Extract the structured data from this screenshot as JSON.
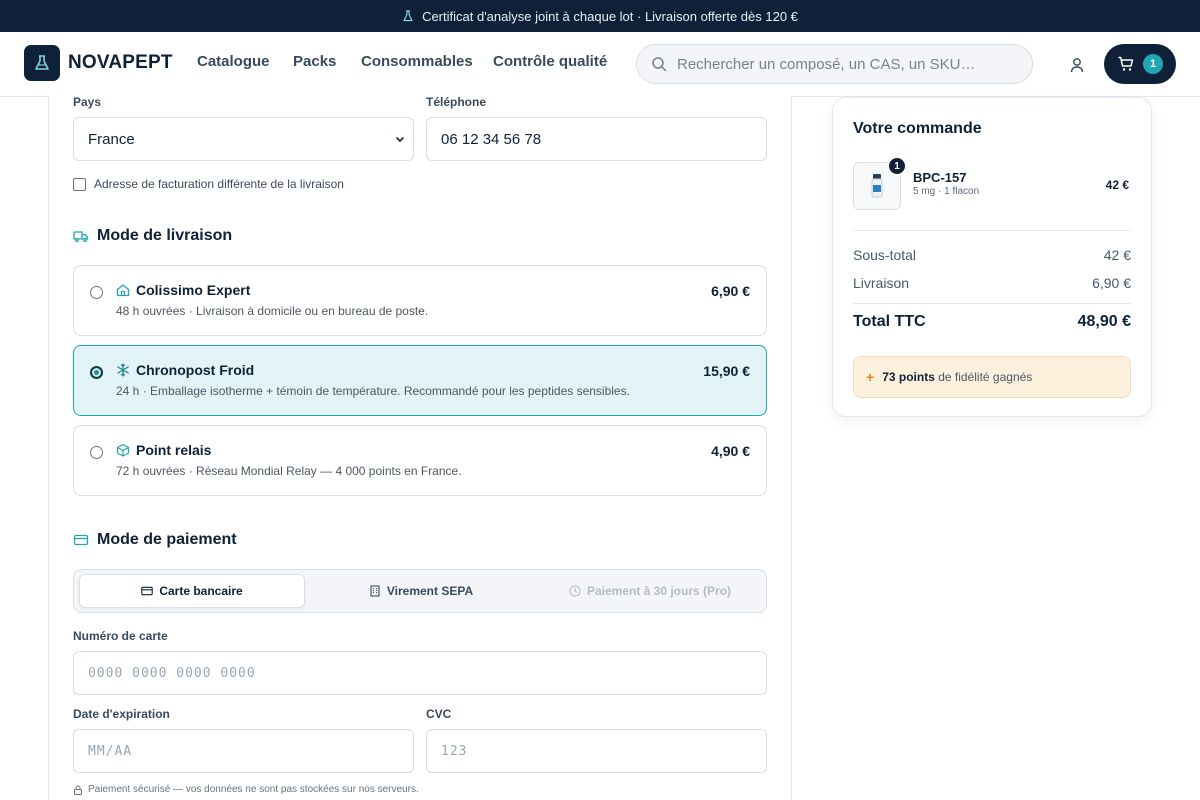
{
  "topbar": {
    "text": "Certificat d'analyse joint à chaque lot · Livraison offerte dès 120 €",
    "icon": "flask-icon"
  },
  "header": {
    "logo": "NOVAPEPT",
    "nav": [
      "Catalogue",
      "Packs",
      "Consommables",
      "Contrôle qualité"
    ],
    "search_placeholder": "Rechercher un composé, un CAS, un SKU…",
    "cart_count": "1"
  },
  "form": {
    "country_label": "Pays",
    "country_value": "France",
    "phone_label": "Téléphone",
    "phone_value": "06 12 34 56 78",
    "billing_checkbox": "Adresse de facturation différente de la livraison"
  },
  "shipping": {
    "title": "Mode de livraison",
    "options": [
      {
        "name": "Colissimo Expert",
        "desc": "48 h ouvrées · Livraison à domicile ou en bureau de poste.",
        "price": "6,90 €",
        "selected": false,
        "icon": "house-icon"
      },
      {
        "name": "Chronopost Froid",
        "desc": "24 h · Emballage isotherme + témoin de température. Recommandé pour les peptides sensibles.",
        "price": "15,90 €",
        "selected": true,
        "icon": "snowflake-icon"
      },
      {
        "name": "Point relais",
        "desc": "72 h ouvrées · Réseau Mondial Relay — 4 000 points en France.",
        "price": "4,90 €",
        "selected": false,
        "icon": "package-icon"
      }
    ]
  },
  "payment": {
    "title": "Mode de paiement",
    "tabs": [
      {
        "label": "Carte bancaire",
        "state": "active",
        "icon": "card-icon"
      },
      {
        "label": "Virement SEPA",
        "state": "normal",
        "icon": "bank-icon"
      },
      {
        "label": "Paiement à 30 jours (Pro)",
        "state": "disabled",
        "icon": "clock-icon"
      }
    ],
    "card_number_label": "Numéro de carte",
    "card_number_placeholder": "0000 0000 0000 0000",
    "expiry_label": "Date d'expiration",
    "expiry_placeholder": "MM/AA",
    "cvc_label": "CVC",
    "cvc_placeholder": "123",
    "secure_note": "Paiement sécurisé — vos données ne sont pas stockées sur nos serveurs."
  },
  "summary": {
    "title": "Votre commande",
    "item": {
      "name": "BPC-157",
      "meta": "5 mg · 1 flacon",
      "price": "42 €",
      "qty": "1"
    },
    "subtotal_label": "Sous-total",
    "subtotal_value": "42 €",
    "shipping_label": "Livraison",
    "shipping_value": "6,90 €",
    "total_label": "Total TTC",
    "total_value": "48,90 €",
    "loyalty_points": "73 points",
    "loyalty_text": "de fidélité gagnés"
  },
  "colors": {
    "navy": "#0f2138",
    "accent": "#21a6b4",
    "selected_bg": "#e2f4f7",
    "loyalty_bg": "#fdf1de"
  }
}
